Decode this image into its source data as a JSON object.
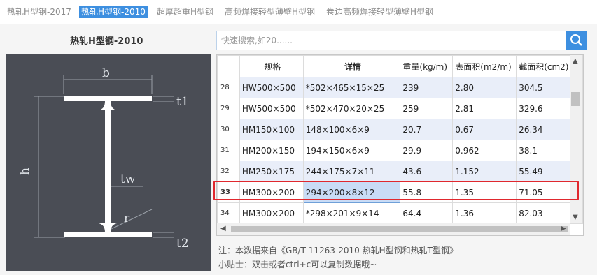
{
  "tabs": [
    "热轧H型钢-2017",
    "热轧H型钢-2010",
    "超厚超重H型钢",
    "高频焊接轻型薄壁H型钢",
    "卷边高频焊接轻型薄壁H型钢"
  ],
  "active_tab": 1,
  "left_title": "热轧H型钢-2010",
  "diagram": {
    "labels": {
      "b": "b",
      "h": "h",
      "t1": "t1",
      "t2": "t2",
      "tw": "tw",
      "r": "r"
    }
  },
  "search": {
    "placeholder": "快速搜索,如20......",
    "icon": "search-icon"
  },
  "table": {
    "headers": [
      "规格",
      "详情",
      "重量(kg/m)",
      "表面积(m2/m)",
      "截面积(cm2)"
    ],
    "rows": [
      {
        "n": "28",
        "spec": "HW500×500",
        "detail": "*502×465×15×25",
        "weight": "239",
        "surface": "2.80",
        "area": "304.5"
      },
      {
        "n": "29",
        "spec": "HW500×500",
        "detail": "*502×470×20×25",
        "weight": "259",
        "surface": "2.81",
        "area": "329.6"
      },
      {
        "n": "30",
        "spec": "HM150×100",
        "detail": "148×100×6×9",
        "weight": "20.7",
        "surface": "0.67",
        "area": "26.34"
      },
      {
        "n": "31",
        "spec": "HM200×150",
        "detail": "194×150×6×9",
        "weight": "29.9",
        "surface": "0.962",
        "area": "38.1"
      },
      {
        "n": "32",
        "spec": "HM250×175",
        "detail": "244×175×7×11",
        "weight": "43.6",
        "surface": "1.152",
        "area": "55.49"
      },
      {
        "n": "33",
        "spec": "HM300×200",
        "detail": "294×200×8×12",
        "weight": "55.8",
        "surface": "1.35",
        "area": "71.05"
      },
      {
        "n": "34",
        "spec": "HM300×200",
        "detail": "*298×201×9×14",
        "weight": "64.4",
        "surface": "1.36",
        "area": "82.03"
      }
    ],
    "selected_row": "33"
  },
  "notes": {
    "source": "注：本数据来自《GB/T 11263-2010 热轧H型钢和热轧T型钢》",
    "tip": "小贴士：双击或者ctrl+c可以复制数据哦~"
  },
  "colors": {
    "accent": "#3d8fe0",
    "highlight": "#e0282e",
    "diagram_bg": "#4a4d55"
  }
}
